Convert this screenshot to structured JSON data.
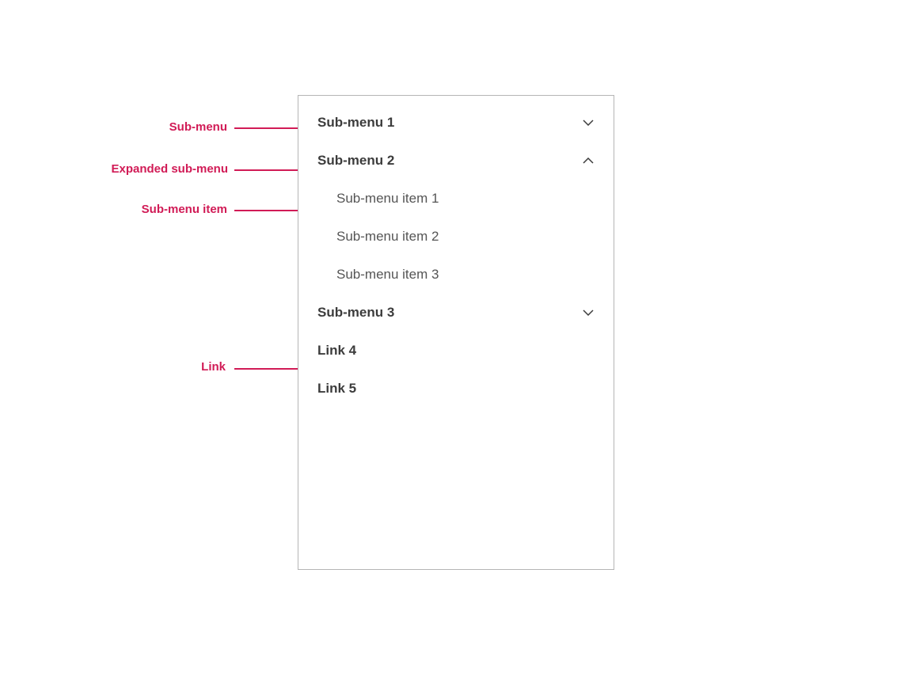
{
  "annotations": {
    "submenu": "Sub-menu",
    "expanded": "Expanded sub-menu",
    "subitem": "Sub-menu item",
    "link": "Link"
  },
  "menu": {
    "submenu1": "Sub-menu 1",
    "submenu2": "Sub-menu 2",
    "submenu3": "Sub-menu 3",
    "link4": "Link 4",
    "link5": "Link 5",
    "items": {
      "item1": "Sub-menu item 1",
      "item2": "Sub-menu item 2",
      "item3": "Sub-menu item 3"
    }
  }
}
